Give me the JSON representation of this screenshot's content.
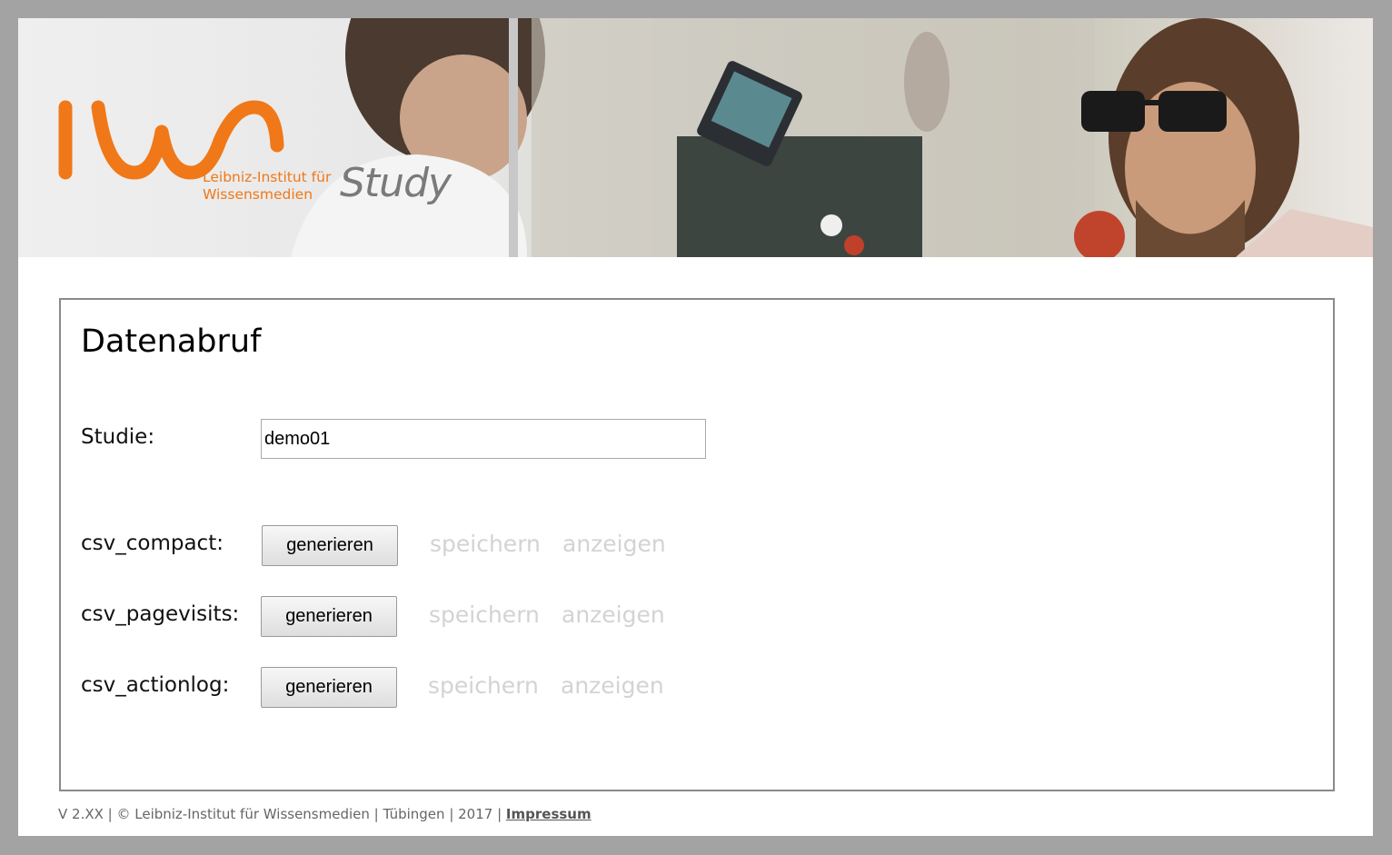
{
  "banner": {
    "logo_text": "IWM",
    "institute_line1": "Leibniz-Institut für",
    "institute_line2": "Wissensmedien",
    "study_word": "Study",
    "accent_color": "#f07818"
  },
  "panel": {
    "title": "Datenabruf",
    "study": {
      "label": "Studie:",
      "value": "demo01"
    },
    "exports": [
      {
        "label": "csv_compact:",
        "generate": "generieren",
        "save": "speichern",
        "show": "anzeigen"
      },
      {
        "label": "csv_pagevisits:",
        "generate": "generieren",
        "save": "speichern",
        "show": "anzeigen"
      },
      {
        "label": "csv_actionlog:",
        "generate": "generieren",
        "save": "speichern",
        "show": "anzeigen"
      }
    ]
  },
  "footer": {
    "text": "V 2.XX | © Leibniz-Institut für Wissensmedien | Tübingen | 2017 |",
    "impressum": "Impressum"
  }
}
